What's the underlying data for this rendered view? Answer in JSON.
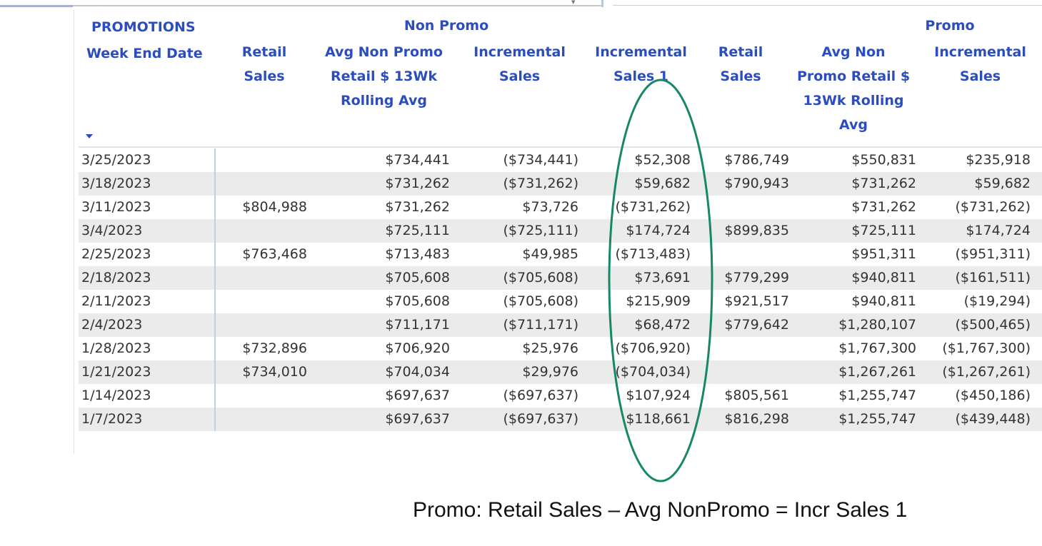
{
  "header": {
    "promotions_label": "PROMOTIONS",
    "week_end_date_label": "Week End Date",
    "non_promo_group_label": "Non Promo",
    "promo_group_label": "Promo",
    "np_retail_sales_line1": "Retail",
    "np_retail_sales_line2": "Sales",
    "np_avg_line1": "Avg Non Promo",
    "np_avg_line2": "Retail $ 13Wk",
    "np_avg_line3": "Rolling Avg",
    "np_incr_line1": "Incremental",
    "np_incr_line2": "Sales",
    "np_incr1_line1": "Incremental",
    "np_incr1_line2": "Sales 1",
    "p_retail_sales_line1": "Retail",
    "p_retail_sales_line2": "Sales",
    "p_avg_line1": "Avg Non",
    "p_avg_line2": "Promo Retail $",
    "p_avg_line3": "13Wk Rolling",
    "p_avg_line4": "Avg",
    "p_incr_line1": "Incremental",
    "p_incr_line2": "Sales"
  },
  "rows": [
    {
      "date": "3/25/2023",
      "np_retail": "",
      "np_avg": "$734,441",
      "np_incr": "($734,441)",
      "incr1": "$52,308",
      "p_retail": "$786,749",
      "p_avg": "$550,831",
      "p_incr": "$235,918"
    },
    {
      "date": "3/18/2023",
      "np_retail": "",
      "np_avg": "$731,262",
      "np_incr": "($731,262)",
      "incr1": "$59,682",
      "p_retail": "$790,943",
      "p_avg": "$731,262",
      "p_incr": "$59,682"
    },
    {
      "date": "3/11/2023",
      "np_retail": "$804,988",
      "np_avg": "$731,262",
      "np_incr": "$73,726",
      "incr1": "($731,262)",
      "p_retail": "",
      "p_avg": "$731,262",
      "p_incr": "($731,262)"
    },
    {
      "date": "3/4/2023",
      "np_retail": "",
      "np_avg": "$725,111",
      "np_incr": "($725,111)",
      "incr1": "$174,724",
      "p_retail": "$899,835",
      "p_avg": "$725,111",
      "p_incr": "$174,724"
    },
    {
      "date": "2/25/2023",
      "np_retail": "$763,468",
      "np_avg": "$713,483",
      "np_incr": "$49,985",
      "incr1": "($713,483)",
      "p_retail": "",
      "p_avg": "$951,311",
      "p_incr": "($951,311)"
    },
    {
      "date": "2/18/2023",
      "np_retail": "",
      "np_avg": "$705,608",
      "np_incr": "($705,608)",
      "incr1": "$73,691",
      "p_retail": "$779,299",
      "p_avg": "$940,811",
      "p_incr": "($161,511)"
    },
    {
      "date": "2/11/2023",
      "np_retail": "",
      "np_avg": "$705,608",
      "np_incr": "($705,608)",
      "incr1": "$215,909",
      "p_retail": "$921,517",
      "p_avg": "$940,811",
      "p_incr": "($19,294)"
    },
    {
      "date": "2/4/2023",
      "np_retail": "",
      "np_avg": "$711,171",
      "np_incr": "($711,171)",
      "incr1": "$68,472",
      "p_retail": "$779,642",
      "p_avg": "$1,280,107",
      "p_incr": "($500,465)"
    },
    {
      "date": "1/28/2023",
      "np_retail": "$732,896",
      "np_avg": "$706,920",
      "np_incr": "$25,976",
      "incr1": "($706,920)",
      "p_retail": "",
      "p_avg": "$1,767,300",
      "p_incr": "($1,767,300)"
    },
    {
      "date": "1/21/2023",
      "np_retail": "$734,010",
      "np_avg": "$704,034",
      "np_incr": "$29,976",
      "incr1": "($704,034)",
      "p_retail": "",
      "p_avg": "$1,267,261",
      "p_incr": "($1,267,261)"
    },
    {
      "date": "1/14/2023",
      "np_retail": "",
      "np_avg": "$697,637",
      "np_incr": "($697,637)",
      "incr1": "$107,924",
      "p_retail": "$805,561",
      "p_avg": "$1,255,747",
      "p_incr": "($450,186)"
    },
    {
      "date": "1/7/2023",
      "np_retail": "",
      "np_avg": "$697,637",
      "np_incr": "($697,637)",
      "incr1": "$118,661",
      "p_retail": "$816,298",
      "p_avg": "$1,255,747",
      "p_incr": "($439,448)"
    }
  ],
  "annotation": {
    "formula_text": "Promo:  Retail Sales – Avg NonPromo = Incr Sales 1",
    "ellipse_color": "#17876a"
  },
  "colors": {
    "header_text": "#2b4dbd",
    "cell_text": "#333333",
    "alt_row": "#ebebeb"
  }
}
